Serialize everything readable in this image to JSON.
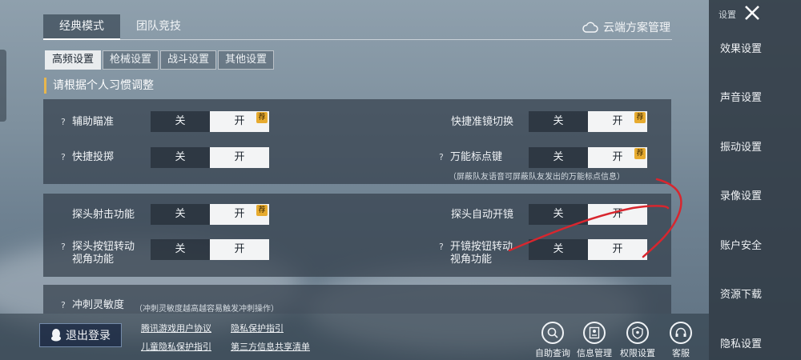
{
  "top_tabs": [
    "经典模式",
    "团队竞技"
  ],
  "cloud_manage": "云端方案管理",
  "sub_tabs": [
    "高频设置",
    "枪械设置",
    "战斗设置",
    "其他设置"
  ],
  "section_title": "请根据个人习惯调整",
  "toggle": {
    "off": "关",
    "on": "开",
    "recommend": "荐"
  },
  "settings": {
    "aim_assist": {
      "label": "辅助瞄准",
      "value": "开"
    },
    "quick_scope_switch": {
      "label": "快捷准镜切换",
      "value": "开"
    },
    "quick_throw": {
      "label": "快捷投掷",
      "value": "开"
    },
    "universal_marker": {
      "label": "万能标点键",
      "value": "开"
    },
    "marker_note": "（屏蔽队友语音可屏蔽队友发出的万能标点信息）",
    "peek_fire": {
      "label": "探头射击功能",
      "value": "开"
    },
    "peek_auto_scope": {
      "label": "探头自动开镜",
      "value": "开"
    },
    "peek_button_rotate": {
      "label_line1": "探头按钮转动",
      "label_line2": "视角功能",
      "value": "开"
    },
    "scope_button_rotate": {
      "label_line1": "开镜按钮转动",
      "label_line2": "视角功能",
      "value": "开"
    },
    "sprint_sensitivity": {
      "label": "冲刺灵敏度",
      "note": "（冲刺灵敏度越高越容易触发冲刺操作）"
    }
  },
  "bottom": {
    "logout": "退出登录",
    "links": [
      "腾讯游戏用户协议",
      "隐私保护指引",
      "儿童隐私保护指引",
      "第三方信息共享清单"
    ],
    "icons": [
      {
        "label": "自助查询",
        "icon": "search-icon"
      },
      {
        "label": "信息管理",
        "icon": "id-card-icon"
      },
      {
        "label": "权限设置",
        "icon": "shield-icon"
      },
      {
        "label": "客服",
        "icon": "headset-icon"
      }
    ]
  },
  "sidebar": {
    "title": "设置",
    "items": [
      "效果设置",
      "声音设置",
      "振动设置",
      "录像设置",
      "账户安全",
      "资源下载",
      "隐私设置"
    ]
  }
}
